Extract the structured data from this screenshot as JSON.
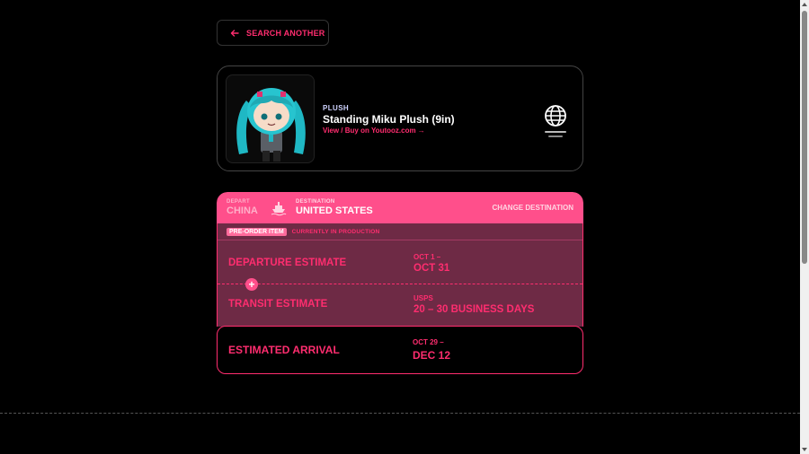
{
  "nav": {
    "back_label": "SEARCH ANOTHER"
  },
  "product": {
    "category": "PLUSH",
    "name": "Standing Miku Plush (9in)",
    "link": "View / Buy on Youtooz.com →",
    "icon": "globe-icon"
  },
  "shipping": {
    "depart_label": "DEPART",
    "depart_value": "CHINA",
    "destination_label": "DESTINATION",
    "destination_value": "UNITED STATES",
    "change_label": "CHANGE DESTINATION",
    "status_badge": "PRE-ORDER ITEM",
    "status_text": "CURRENTLY IN PRODUCTION",
    "departure": {
      "title": "DEPARTURE ESTIMATE",
      "sub": "OCT 1 –",
      "value": "OCT 31"
    },
    "transit": {
      "title": "TRANSIT ESTIMATE",
      "sub": "USPS",
      "value": "20 – 30 BUSINESS DAYS"
    },
    "arrival": {
      "title": "ESTIMATED ARRIVAL",
      "sub": "OCT 29 –",
      "value": "DEC 12"
    }
  },
  "colors": {
    "accent": "#ff2d6f",
    "header": "#ff4f8b",
    "panel": "#6e2a45"
  }
}
